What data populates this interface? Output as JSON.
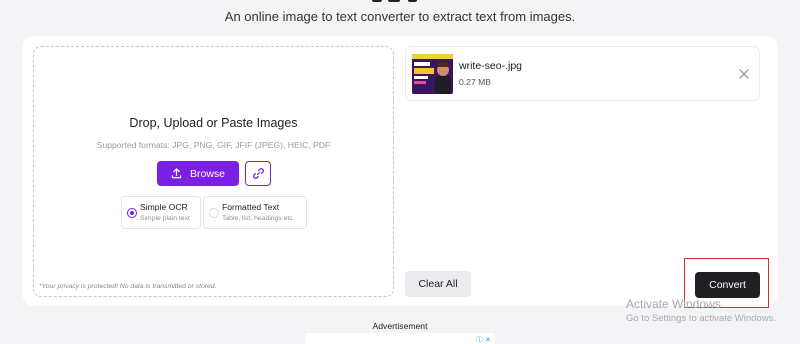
{
  "header": {
    "subtitle": "An online image to text converter to extract text from images."
  },
  "upload": {
    "title": "Drop, Upload or Paste Images",
    "formats": "Supported formats: JPG, PNG, GIF, JFIF (JPEG), HEIC, PDF",
    "browse_label": "Browse",
    "privacy_note": "*Your privacy is protected! No data is transmitted or stored."
  },
  "options": [
    {
      "title": "Simple OCR",
      "subtitle": "Simple plain text",
      "selected": true
    },
    {
      "title": "Formatted Text",
      "subtitle": "Table, list, headings etc.",
      "selected": false
    }
  ],
  "file": {
    "name": "write-seo-.jpg",
    "size": "0.27 MB"
  },
  "actions": {
    "clear_label": "Clear All",
    "convert_label": "Convert"
  },
  "watermark": {
    "line1": "Activate Windows",
    "line2": "Go to Settings to activate Windows."
  },
  "ad": {
    "label": "Advertisement"
  },
  "colors": {
    "accent": "#7b1fe4",
    "convert_bg": "#1f1f24",
    "highlight_outline": "#d23030"
  }
}
